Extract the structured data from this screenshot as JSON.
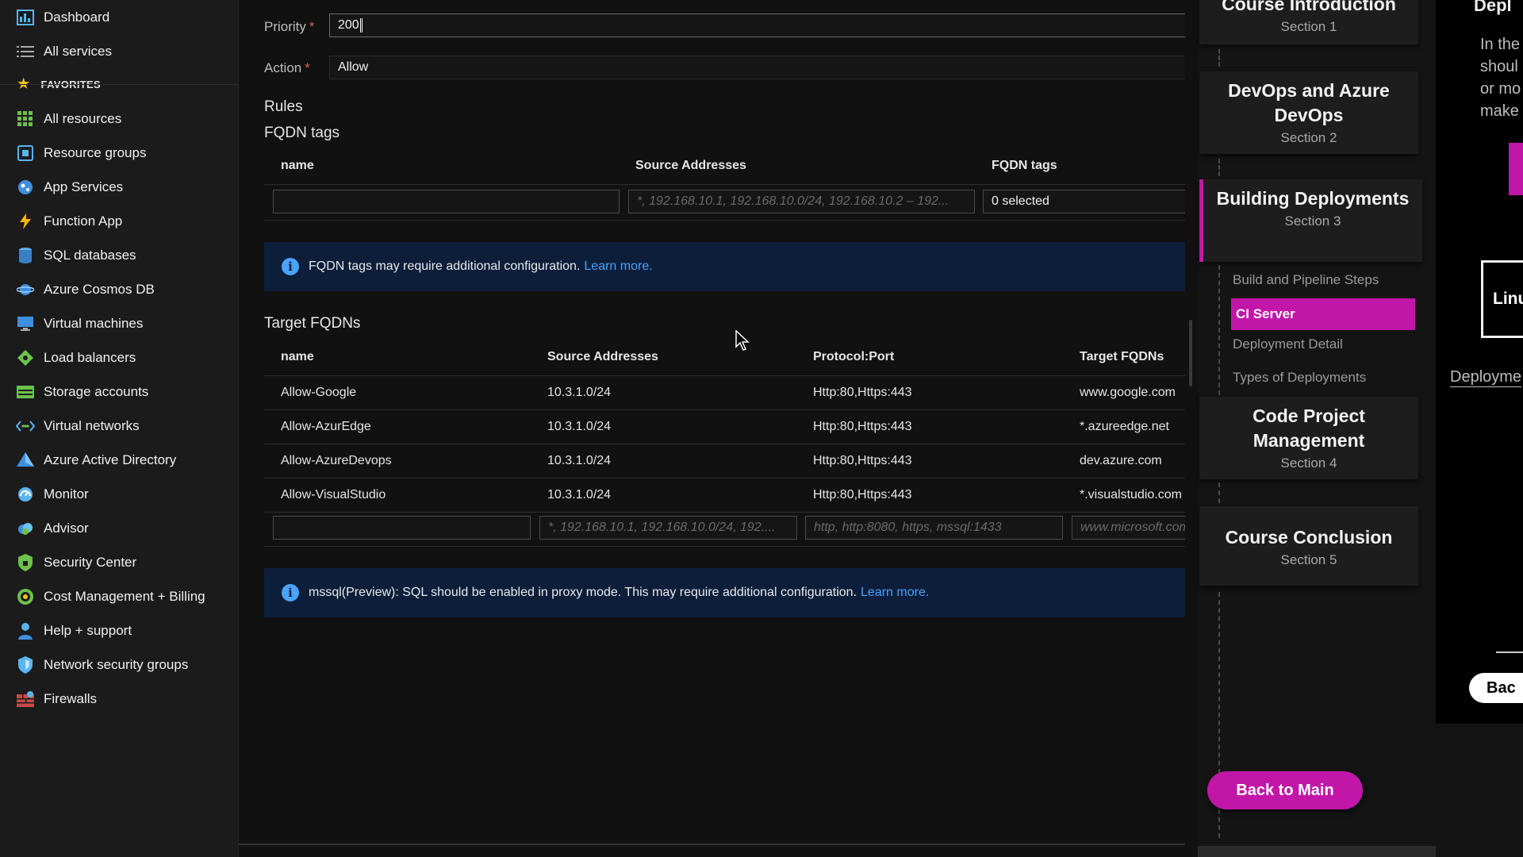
{
  "sidebar": {
    "items": [
      {
        "label": "Dashboard",
        "icon": "dashboard-icon"
      },
      {
        "label": "All services",
        "icon": "list-icon"
      }
    ],
    "favorites_label": "FAVORITES",
    "favorites": [
      {
        "label": "All resources",
        "icon": "grid-icon"
      },
      {
        "label": "Resource groups",
        "icon": "cube-icon"
      },
      {
        "label": "App Services",
        "icon": "globe-icon"
      },
      {
        "label": "Function App",
        "icon": "bolt-icon"
      },
      {
        "label": "SQL databases",
        "icon": "database-icon"
      },
      {
        "label": "Azure Cosmos DB",
        "icon": "planet-icon"
      },
      {
        "label": "Virtual machines",
        "icon": "monitor-icon"
      },
      {
        "label": "Load balancers",
        "icon": "diamond-icon"
      },
      {
        "label": "Storage accounts",
        "icon": "storage-icon"
      },
      {
        "label": "Virtual networks",
        "icon": "network-icon"
      },
      {
        "label": "Azure Active Directory",
        "icon": "pyramid-icon"
      },
      {
        "label": "Monitor",
        "icon": "gauge-icon"
      },
      {
        "label": "Advisor",
        "icon": "cloud-icon"
      },
      {
        "label": "Security Center",
        "icon": "shield-icon"
      },
      {
        "label": "Cost Management + Billing",
        "icon": "coin-icon"
      },
      {
        "label": "Help + support",
        "icon": "person-icon"
      },
      {
        "label": "Network security groups",
        "icon": "shield-network-icon"
      },
      {
        "label": "Firewalls",
        "icon": "firewall-icon"
      }
    ]
  },
  "form": {
    "priority_label": "Priority",
    "priority_value": "200",
    "action_label": "Action",
    "action_value": "Allow",
    "required_mark": "*"
  },
  "rules": {
    "title": "Rules",
    "fqdn_tags": {
      "title": "FQDN tags",
      "headers": [
        "name",
        "Source Addresses",
        "FQDN tags"
      ],
      "source_placeholder": "*, 192.168.10.1, 192.168.10.0/24, 192.168.10.2 – 192...",
      "tags_value": "0 selected",
      "info_text": "FQDN tags may require additional configuration.",
      "info_link": "Learn more."
    },
    "target_fqdns": {
      "title": "Target FQDNs",
      "headers": [
        "name",
        "Source Addresses",
        "Protocol:Port",
        "Target FQDNs"
      ],
      "rows": [
        {
          "name": "Allow-Google",
          "source": "10.3.1.0/24",
          "protocol": "Http:80,Https:443",
          "target": "www.google.com"
        },
        {
          "name": "Allow-AzurEdge",
          "source": "10.3.1.0/24",
          "protocol": "Http:80,Https:443",
          "target": "*.azureedge.net"
        },
        {
          "name": "Allow-AzureDevops",
          "source": "10.3.1.0/24",
          "protocol": "Http:80,Https:443",
          "target": "dev.azure.com"
        },
        {
          "name": "Allow-VisualStudio",
          "source": "10.3.1.0/24",
          "protocol": "Http:80,Https:443",
          "target": "*.visualstudio.com"
        }
      ],
      "source_placeholder": "*, 192.168.10.1, 192.168.10.0/24, 192....",
      "protocol_placeholder": "http, http:8080, https, mssql:1433",
      "target_placeholder": "www.microsoft.com",
      "info_text": "mssql(Preview): SQL should be enabled in proxy mode. This may require additional configuration.",
      "info_link": "Learn more."
    }
  },
  "course": {
    "sections": [
      {
        "title": "Course Introduction",
        "section": "Section 1"
      },
      {
        "title": "DevOps and Azure DevOps",
        "section": "Section 2"
      },
      {
        "title": "Building Deployments",
        "section": "Section 3"
      },
      {
        "title": "Code Project Management",
        "section": "Section 4"
      },
      {
        "title": "Course Conclusion",
        "section": "Section 5"
      }
    ],
    "subitems": [
      "Build and Pipeline Steps",
      "CI Server",
      "Deployment Detail",
      "Types of Deployments"
    ],
    "back_label": "Back to Main",
    "accent": "#c216a8"
  },
  "right_panel": {
    "title": "Depl",
    "text_lines": [
      "In the",
      "shoul",
      "or mo",
      "make"
    ],
    "box_label": "Linu",
    "deploy_label": "Deployme",
    "back_label": "Bac"
  },
  "colors": {
    "info_bg": "#0c1e3a",
    "link": "#4aa3ff",
    "accent": "#c216a8"
  }
}
